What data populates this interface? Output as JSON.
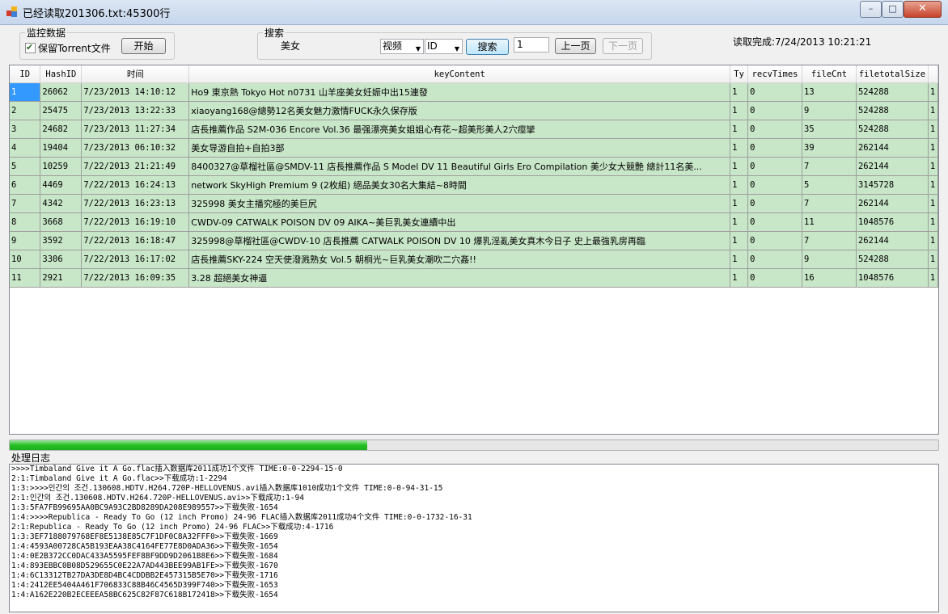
{
  "window": {
    "title": "已经读取201306.txt:45300行",
    "minimize_glyph": "–",
    "maximize_glyph": "□",
    "close_glyph": "✕"
  },
  "monitor": {
    "group_label": "监控数据",
    "keep_torrent_label": "保留Torrent文件",
    "keep_torrent_checked": true,
    "start_button": "开始"
  },
  "search": {
    "group_label": "搜索",
    "query": "美女",
    "type_selected": "视频",
    "field_selected": "ID",
    "search_button": "搜索",
    "page": "1",
    "prev_button": "上一页",
    "next_button": "下一页"
  },
  "status": {
    "text": "读取完成:7/24/2013 10:21:21"
  },
  "grid": {
    "columns": [
      "ID",
      "HashID",
      "时间",
      "keyContent",
      "Ty",
      "recvTimes",
      "fileCnt",
      "filetotalSize",
      ""
    ],
    "rows": [
      [
        "1",
        "26062",
        "7/23/2013 14:10:12",
        "Ho9 東京熱 Tokyo Hot n0731 山羊座美女妊娠中出15連發",
        "1",
        "0",
        "13",
        "524288",
        "1"
      ],
      [
        "2",
        "25475",
        "7/23/2013 13:22:33",
        "xiaoyang168@總勢12名美女魅力激情FUCK永久保存版",
        "1",
        "0",
        "9",
        "524288",
        "1"
      ],
      [
        "3",
        "24682",
        "7/23/2013 11:27:34",
        "店長推薦作品 S2M-036 Encore Vol.36 最强漂亮美女姐姐心有花~超美形美人2穴痙攣",
        "1",
        "0",
        "35",
        "524288",
        "1"
      ],
      [
        "4",
        "19404",
        "7/23/2013 06:10:32",
        "美女导游自拍+自拍3部",
        "1",
        "0",
        "39",
        "262144",
        "1"
      ],
      [
        "5",
        "10259",
        "7/22/2013 21:21:49",
        "8400327@草榴社區@SMDV-11 店長推薦作品 S Model DV 11 Beautiful Girls Ero Compilation 美少女大競艶 總計11名美...",
        "1",
        "0",
        "7",
        "262144",
        "1"
      ],
      [
        "6",
        "4469",
        "7/22/2013 16:24:13",
        "network SkyHigh Premium 9 (2枚組) 絕品美女30名大集結~8時間",
        "1",
        "0",
        "5",
        "3145728",
        "1"
      ],
      [
        "7",
        "4342",
        "7/22/2013 16:23:13",
        "325998 美女主播究極的美巨尻",
        "1",
        "0",
        "7",
        "262144",
        "1"
      ],
      [
        "8",
        "3668",
        "7/22/2013 16:19:10",
        "CWDV-09 CATWALK POISON DV 09 AIKA~美巨乳美女連續中出",
        "1",
        "0",
        "11",
        "1048576",
        "1"
      ],
      [
        "9",
        "3592",
        "7/22/2013 16:18:47",
        "325998@草榴社區@CWDV-10 店長推薦 CATWALK POISON DV 10 爆乳淫亂美女真木今日子 史上最強乳房再臨",
        "1",
        "0",
        "7",
        "262144",
        "1"
      ],
      [
        "10",
        "3306",
        "7/22/2013 16:17:02",
        "店長推薦SKY-224 空天使潑溅熟女 Vol.5 朝桐光~巨乳美女潮吹二穴姦!!",
        "1",
        "0",
        "9",
        "524288",
        "1"
      ],
      [
        "11",
        "2921",
        "7/22/2013 16:09:35",
        "3.28 超絕美女神逼",
        "1",
        "0",
        "16",
        "1048576",
        "1"
      ]
    ]
  },
  "progress": {
    "fraction": 0.385
  },
  "log": {
    "label": "处理日志",
    "lines": [
      ">>>>Timbaland Give it A Go.flac插入数据库2011成功1个文件 TIME:0-0-2294-15-0",
      "2:1:Timbaland Give it A Go.flac>>下载成功:1-2294",
      "1:3:>>>>인간의 조건.130608.HDTV.H264.720P-HELLOVENUS.avi插入数据库1010成功1个文件 TIME:0-0-94-31-15",
      "2:1:인간의 조건.130608.HDTV.H264.720P-HELLOVENUS.avi>>下载成功:1-94",
      "1:3:5FA7FB99695AA0BC9A93C2BD8289DA208E989557>>下载失败-1654",
      "1:4:>>>>Republica - Ready To Go (12 inch Promo) 24-96 FLAC插入数据库2011成功4个文件 TIME:0-0-1732-16-31",
      "2:1:Republica - Ready To Go (12 inch Promo) 24-96 FLAC>>下载成功:4-1716",
      "1:3:3EF7188079768EF8E5138E85C7F1DF0C8A32FFF0>>下载失败-1669",
      "1:4:4593A00728CA5B193EAA38C4164FE77E8D0ADA36>>下载失败-1654",
      "1:4:0E2B372CC0DAC433A5595FEF8BF9DD9D2061B8E6>>下载失败-1684",
      "1:4:893EBBC0B08D529655C0E22A7AD443BEE99AB1FE>>下载失败-1670",
      "1:4:6C13312TB27DA3DE8D4BC4CDDBB2E457315B5E70>>下载失败-1716",
      "1:4:2412EE5404A461F706833C88B46C4565D399F740>>下载失败-1653",
      "1:4:A162E220B2ECEEEA58BC625C82F87C618B172418>>下载失败-1654"
    ]
  }
}
